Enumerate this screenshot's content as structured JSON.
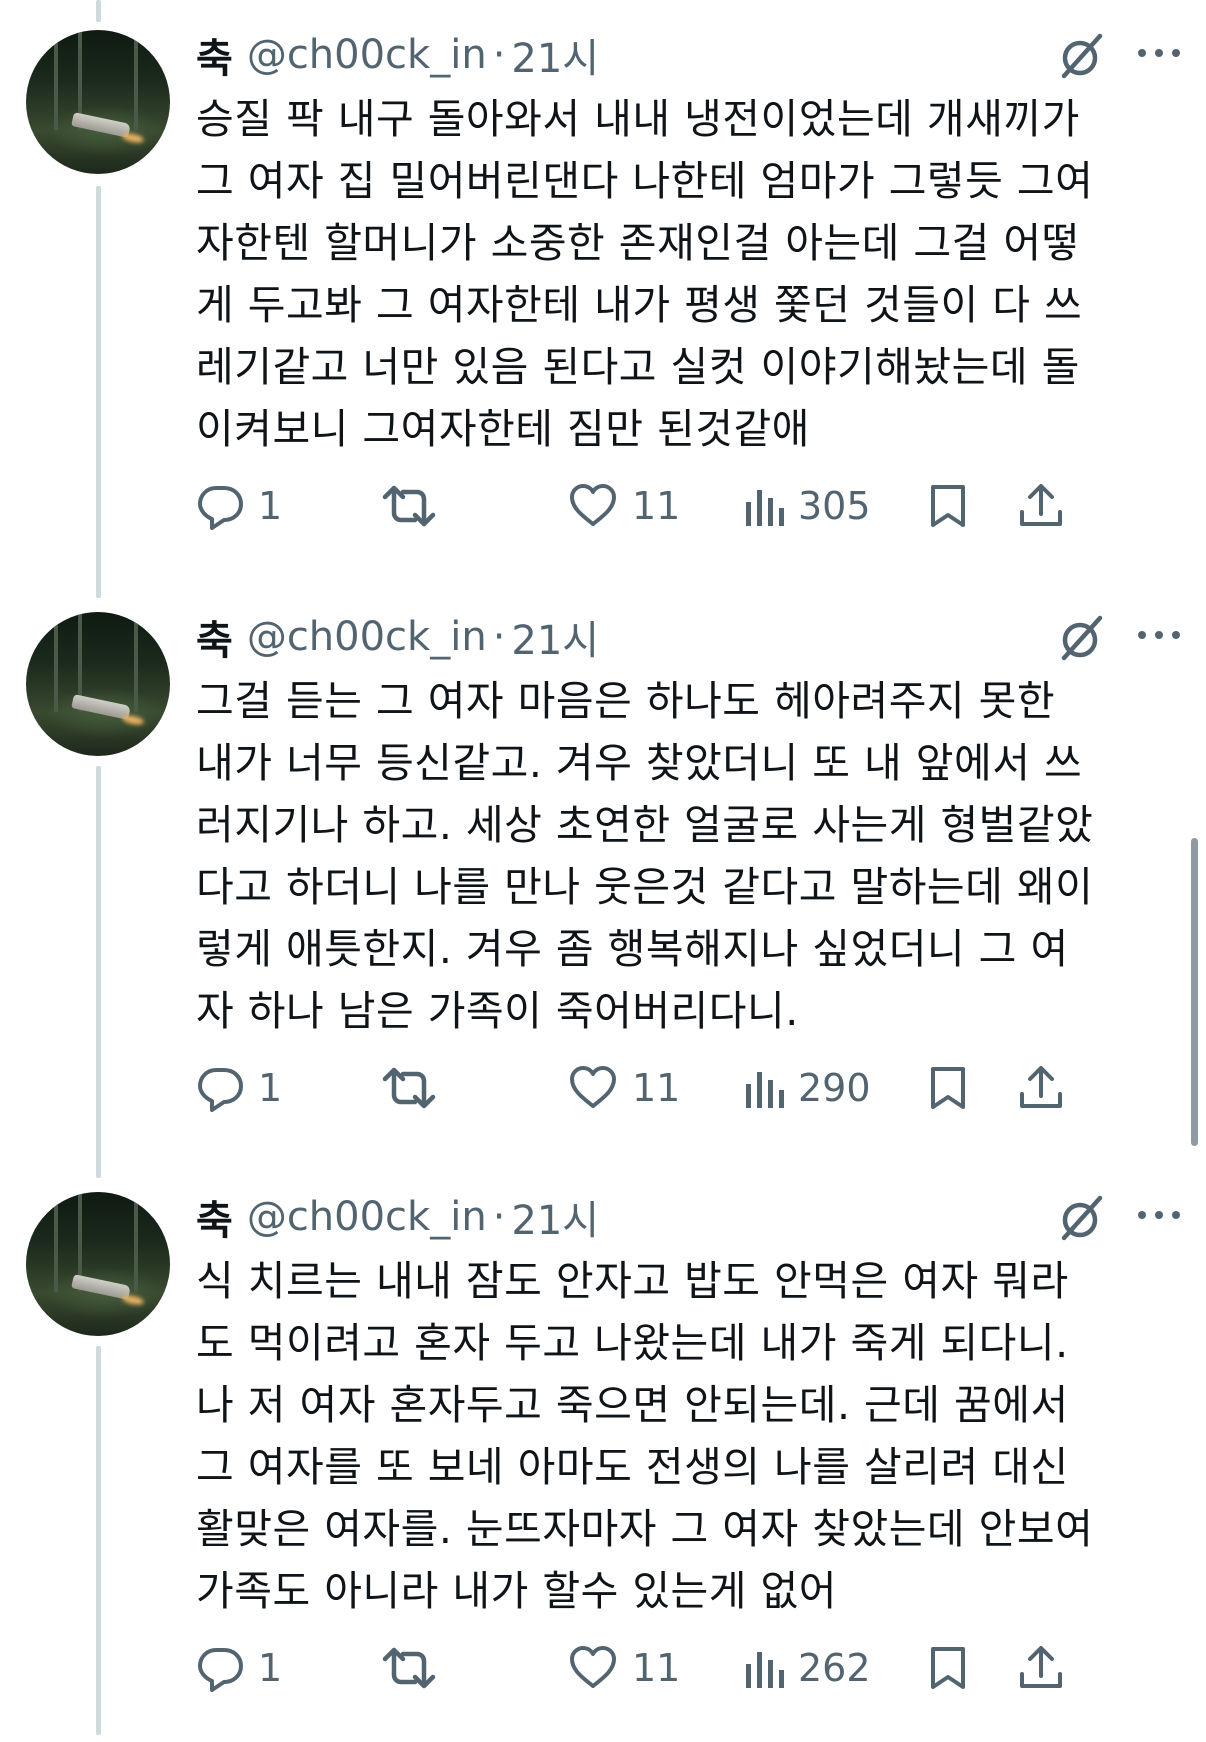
{
  "tweets": [
    {
      "name": "축",
      "handle": "@ch00ck_in",
      "separator": "·",
      "time": "21시",
      "text": "승질 팍 내구 돌아와서 내내 냉전이었는데 개새끼가\n그 여자 집 밀어버린댄다 나한테 엄마가 그렇듯 그여\n자한텐 할머니가 소중한 존재인걸 아는데 그걸 어떻\n게 두고봐 그 여자한테 내가 평생 쫓던 것들이 다 쓰\n레기같고 너만 있음 된다고 실컷 이야기해놨는데 돌\n이켜보니 그여자한테 짐만 된것같애",
      "replies": "1",
      "likes": "11",
      "views": "305"
    },
    {
      "name": "축",
      "handle": "@ch00ck_in",
      "separator": "·",
      "time": "21시",
      "text": "그걸 듣는 그 여자 마음은 하나도 헤아려주지 못한\n내가 너무 등신같고. 겨우 찾았더니 또 내 앞에서 쓰\n러지기나 하고. 세상 초연한 얼굴로 사는게 형벌같았\n다고 하더니 나를 만나 웃은것 같다고 말하는데 왜이\n렇게 애틋한지. 겨우 좀 행복해지나 싶었더니 그 여\n자 하나 남은 가족이 죽어버리다니.",
      "replies": "1",
      "likes": "11",
      "views": "290"
    },
    {
      "name": "축",
      "handle": "@ch00ck_in",
      "separator": "·",
      "time": "21시",
      "text": "식 치르는 내내 잠도 안자고 밥도 안먹은 여자 뭐라\n도 먹이려고 혼자 두고 나왔는데 내가 죽게 되다니.\n나 저 여자 혼자두고 죽으면 안되는데. 근데 꿈에서\n그 여자를 또 보네 아마도 전생의 나를 살리려 대신\n활맞은 여자를. 눈뜨자마자 그 여자 찾았는데 안보여\n가족도 아니라 내가 할수 있는게 없어",
      "replies": "1",
      "likes": "11",
      "views": "262"
    }
  ],
  "icons": {
    "reply": "reply-icon",
    "retweet": "retweet-icon",
    "like": "heart-icon",
    "views": "views-icon",
    "bookmark": "bookmark-icon",
    "share": "share-icon",
    "grok": "grok-icon",
    "more": "more-icon"
  },
  "colors": {
    "text": "#0f1419",
    "secondary": "#536471",
    "thread_line": "#cfd9de"
  }
}
